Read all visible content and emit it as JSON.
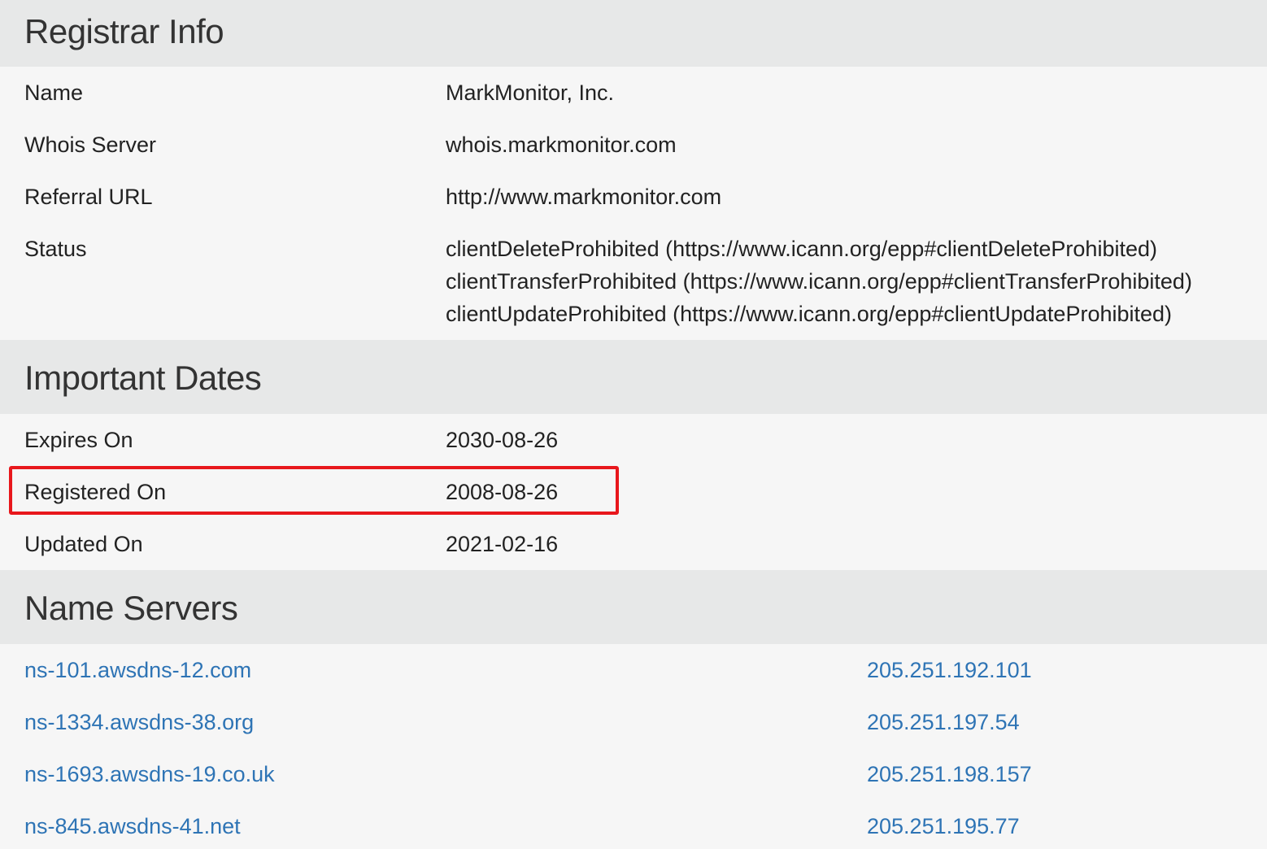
{
  "registrar": {
    "title": "Registrar Info",
    "rows": [
      {
        "label": "Name",
        "value": "MarkMonitor, Inc."
      },
      {
        "label": "Whois Server",
        "value": "whois.markmonitor.com"
      },
      {
        "label": "Referral URL",
        "value": "http://www.markmonitor.com"
      }
    ],
    "status": {
      "label": "Status",
      "values": [
        "clientDeleteProhibited (https://www.icann.org/epp#clientDeleteProhibited)",
        "clientTransferProhibited (https://www.icann.org/epp#clientTransferProhibited)",
        "clientUpdateProhibited (https://www.icann.org/epp#clientUpdateProhibited)"
      ]
    }
  },
  "dates": {
    "title": "Important Dates",
    "rows": [
      {
        "label": "Expires On",
        "value": "2030-08-26"
      },
      {
        "label": "Registered On",
        "value": "2008-08-26"
      },
      {
        "label": "Updated On",
        "value": "2021-02-16"
      }
    ]
  },
  "name_servers": {
    "title": "Name Servers",
    "rows": [
      {
        "host": "ns-101.awsdns-12.com",
        "ip": "205.251.192.101"
      },
      {
        "host": "ns-1334.awsdns-38.org",
        "ip": "205.251.197.54"
      },
      {
        "host": "ns-1693.awsdns-19.co.uk",
        "ip": "205.251.198.157"
      },
      {
        "host": "ns-845.awsdns-41.net",
        "ip": "205.251.195.77"
      }
    ]
  },
  "colors": {
    "link": "#2e74b5",
    "highlight": "#e8171c",
    "header_bg": "#e7e8e8",
    "row_bg": "#f6f6f6"
  }
}
